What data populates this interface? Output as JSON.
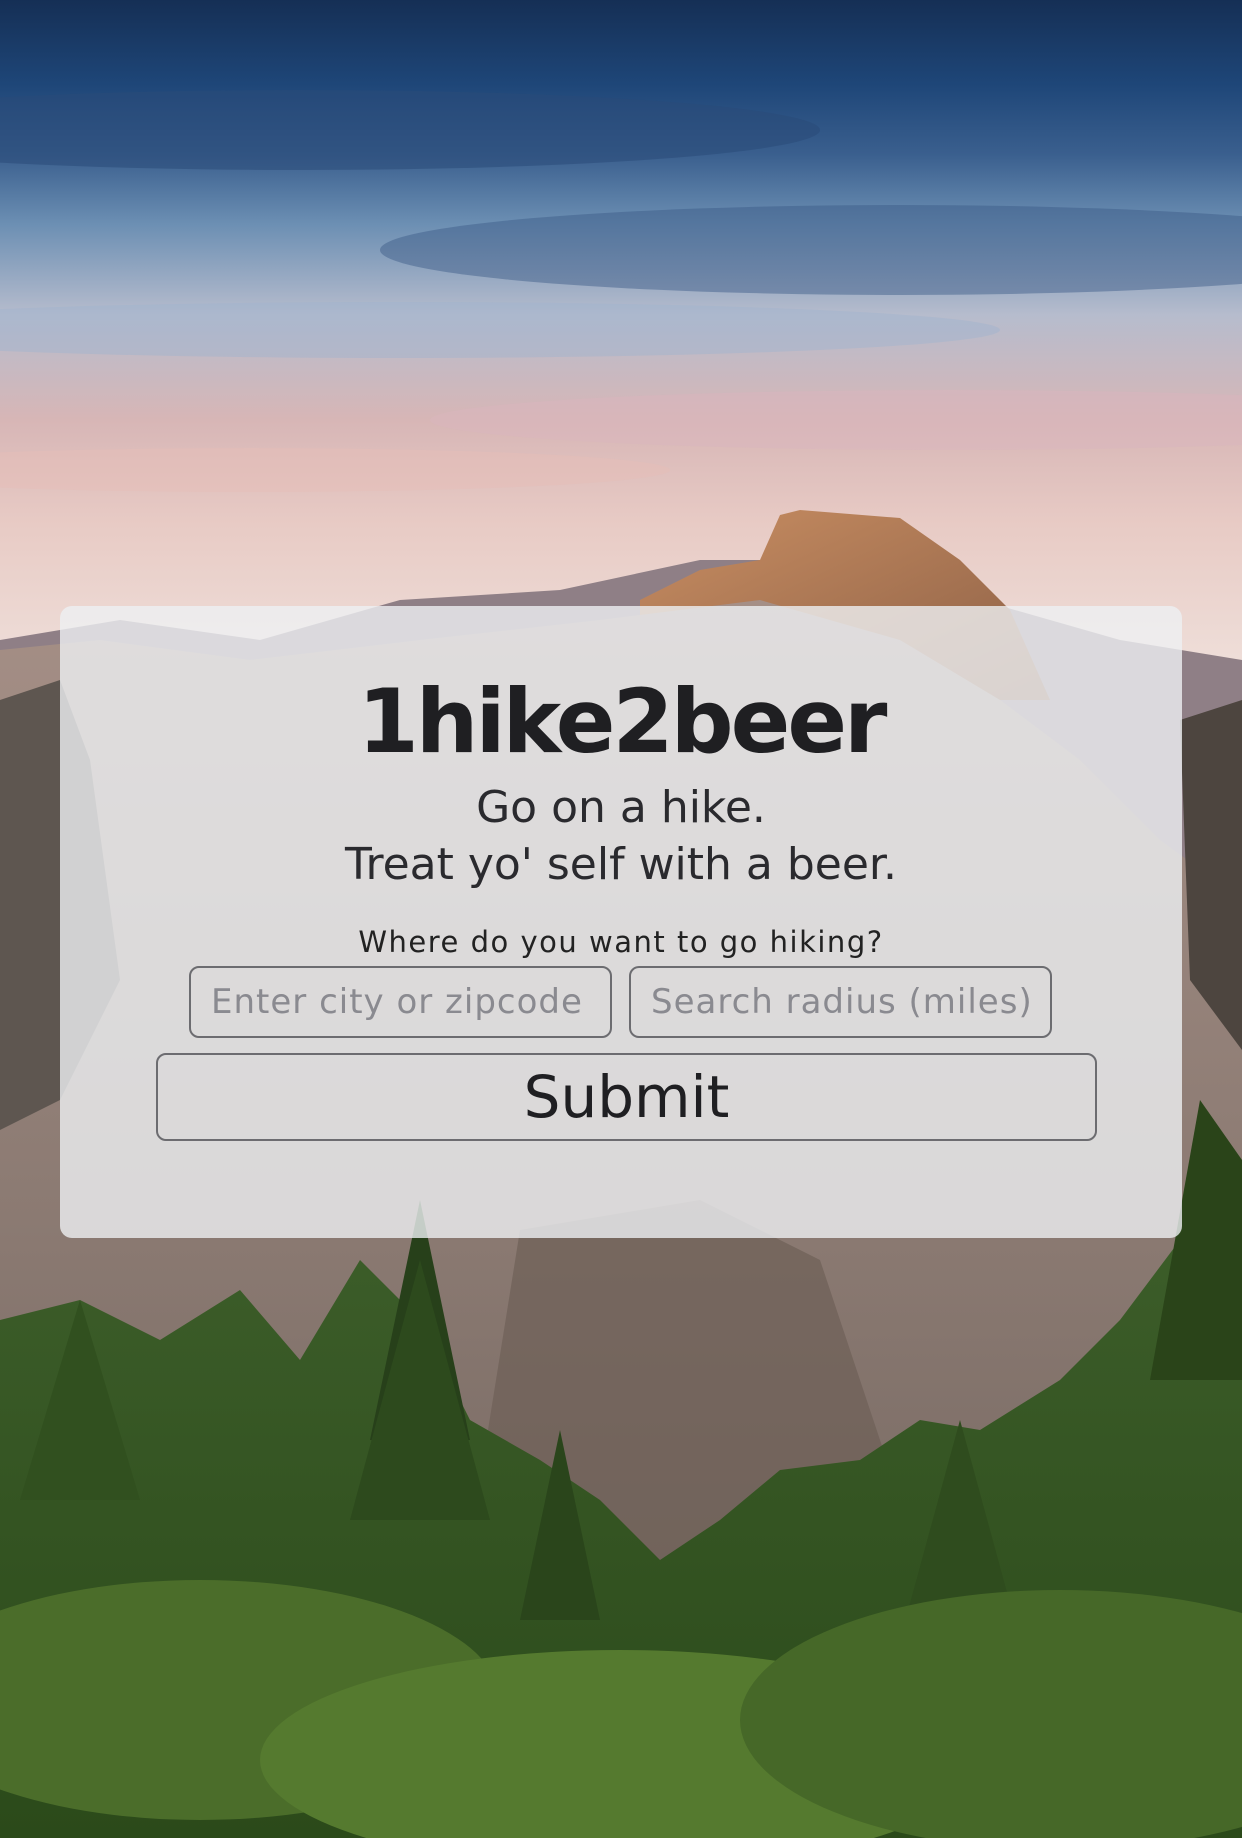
{
  "app": {
    "brand": "1hike2beer",
    "tagline_line1": "Go on a hike.",
    "tagline_line2": "Treat yo' self with a beer."
  },
  "search": {
    "prompt": "Where do you want to go hiking?",
    "location_placeholder": "Enter city or zipcode",
    "radius_placeholder": "Search radius (miles)",
    "submit_label": "Submit"
  },
  "colors": {
    "card_background": "#eef0f3",
    "text": "#1f1f22",
    "border": "#6c6c70",
    "sky_top": "#1b3f6e",
    "sky_horizon": "#e7c6c0",
    "forest": "#3e6a26"
  }
}
